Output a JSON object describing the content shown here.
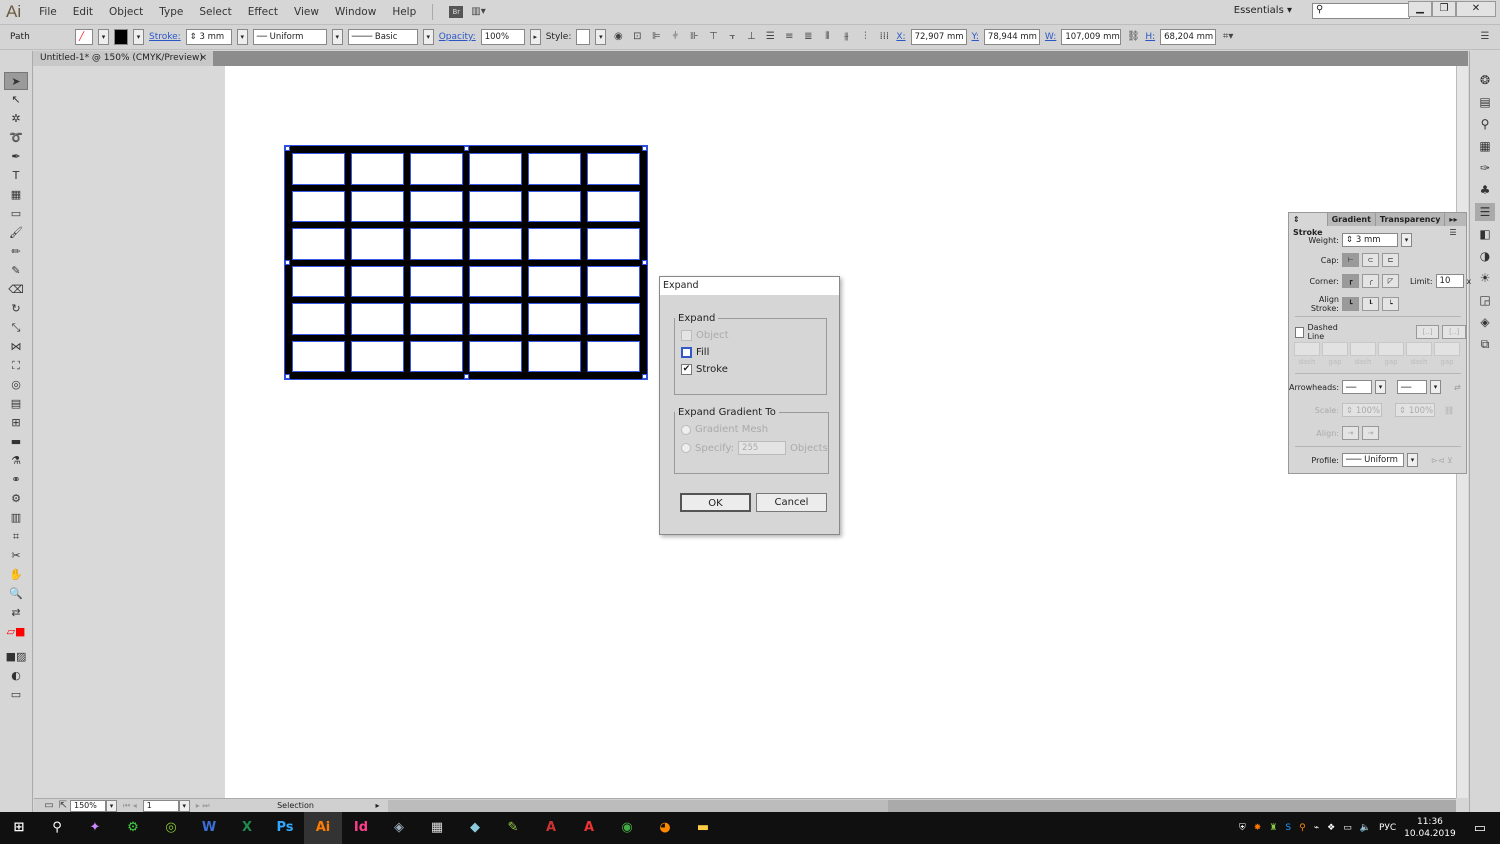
{
  "app": {
    "logo": "Ai",
    "menus": [
      "File",
      "Edit",
      "Object",
      "Type",
      "Select",
      "Effect",
      "View",
      "Window",
      "Help"
    ],
    "bridge": "Br",
    "workspace": "Essentials",
    "search_placeholder": ""
  },
  "control": {
    "selection_type": "Path",
    "stroke_label": "Stroke:",
    "stroke_weight": "3 mm",
    "profile": "Uniform",
    "brush": "Basic",
    "opacity_label": "Opacity:",
    "opacity": "100%",
    "style_label": "Style:",
    "x_label": "X:",
    "x": "72,907 mm",
    "y_label": "Y:",
    "y": "78,944 mm",
    "w_label": "W:",
    "w": "107,009 mm",
    "h_label": "H:",
    "h": "68,204 mm"
  },
  "document": {
    "tab_title": "Untitled-1* @ 150% (CMYK/Preview)",
    "close": "×"
  },
  "artwork": {
    "columns": 6,
    "rows": 6,
    "stroke_color": "#000000",
    "selection_color": "#2f4fe0"
  },
  "status": {
    "zoom": "150%",
    "artboard": "1",
    "tool": "Selection"
  },
  "dialog": {
    "title": "Expand",
    "group1": "Expand",
    "object": "Object",
    "object_checked": false,
    "fill": "Fill",
    "fill_checked": false,
    "stroke": "Stroke",
    "stroke_checked": true,
    "group2": "Expand Gradient To",
    "gradient_mesh": "Gradient Mesh",
    "specify": "Specify:",
    "specify_value": "255",
    "objects": "Objects",
    "ok": "OK",
    "cancel": "Cancel"
  },
  "stroke_panel": {
    "tabs": [
      "Stroke",
      "Gradient",
      "Transparency"
    ],
    "weight_label": "Weight:",
    "weight": "3 mm",
    "cap_label": "Cap:",
    "corner_label": "Corner:",
    "limit_label": "Limit:",
    "limit": "10",
    "limit_unit": "x",
    "align_label": "Align Stroke:",
    "dashed_label": "Dashed Line",
    "dash_labels": [
      "dash",
      "gap",
      "dash",
      "gap",
      "dash",
      "gap"
    ],
    "arrowheads_label": "Arrowheads:",
    "scale_label": "Scale:",
    "scale1": "100%",
    "scale2": "100%",
    "align2_label": "Align:",
    "profile_label": "Profile:",
    "profile": "Uniform"
  },
  "taskbar": {
    "apps": [
      "W",
      "X",
      "Ps",
      "Ai",
      "Id"
    ],
    "lang": "РУС",
    "time": "11:36",
    "date": "10.04.2019"
  }
}
